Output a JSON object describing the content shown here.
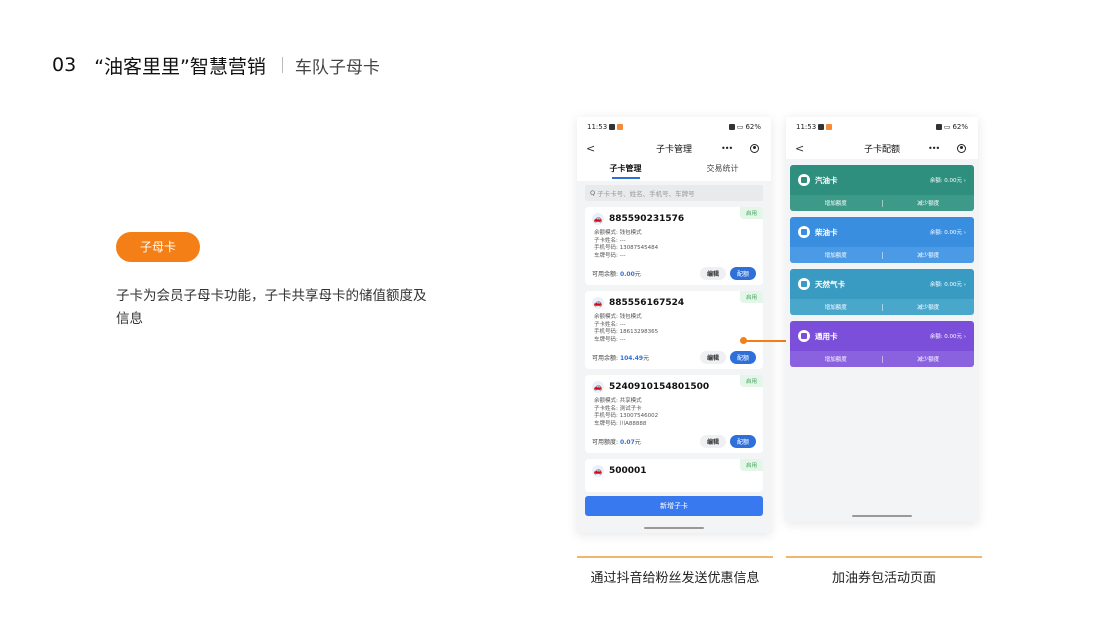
{
  "header": {
    "number": "03",
    "title": "“油客里里”智慧营销",
    "subtitle": "车队子母卡"
  },
  "tag": "子母卡",
  "description": "子卡为会员子母卡功能，子卡共享母卡的储值额度及信息",
  "phone1": {
    "status": {
      "time": "11:53",
      "battery": "62%"
    },
    "nav_title": "子卡管理",
    "tabs": [
      "子卡管理",
      "交易统计"
    ],
    "search_placeholder": "子卡卡号、姓名、手机号、车牌号",
    "cards": [
      {
        "number": "885590231576",
        "badge": "启用",
        "lines": [
          "余额模式: 钱包模式",
          "子卡姓名: ---",
          "手机号码: 13087545484",
          "车牌号码: ---"
        ],
        "balance_label": "可用余额:",
        "balance": "0.00",
        "unit": "元",
        "edit": "编辑",
        "config": "配额"
      },
      {
        "number": "885556167524",
        "badge": "启用",
        "lines": [
          "余额模式: 钱包模式",
          "子卡姓名: ---",
          "手机号码: 18613298365",
          "车牌号码: ---"
        ],
        "balance_label": "可用余额:",
        "balance": "104.49",
        "unit": "元",
        "edit": "编辑",
        "config": "配额"
      },
      {
        "number": "5240910154801500",
        "badge": "启用",
        "lines": [
          "余额模式: 共享模式",
          "子卡姓名: 测试子卡",
          "手机号码: 13007546002",
          "车牌号码: 川A88888"
        ],
        "balance_label": "可用额度:",
        "balance": "0.07",
        "unit": "元",
        "edit": "编辑",
        "config": "配额"
      },
      {
        "number": "500001",
        "badge": "启用"
      }
    ],
    "add_button": "新增子卡"
  },
  "phone2": {
    "status": {
      "time": "11:53",
      "battery": "62%"
    },
    "nav_title": "子卡配额",
    "fuels": [
      {
        "name": "汽油卡",
        "balance": "余额: 0.00元",
        "add": "增加额度",
        "reduce": "减少额度",
        "color": "#2f8f7e",
        "bottom_color": "#3d9a89"
      },
      {
        "name": "柴油卡",
        "balance": "余额: 0.00元",
        "add": "增加额度",
        "reduce": "减少额度",
        "color": "#3a8ee0",
        "bottom_color": "#4a9ae6"
      },
      {
        "name": "天然气卡",
        "balance": "余额: 0.00元",
        "add": "增加额度",
        "reduce": "减少额度",
        "color": "#3a9bc2",
        "bottom_color": "#4aa7cc"
      },
      {
        "name": "通用卡",
        "balance": "余额: 0.00元",
        "add": "增加额度",
        "reduce": "减少额度",
        "color": "#7b4fd9",
        "bottom_color": "#8a62e0"
      }
    ]
  },
  "captions": [
    "通过抖音给粉丝发送优惠信息",
    "加油券包活动页面"
  ],
  "colors": {
    "accent": "#f57f17",
    "primary_blue": "#2f6fd9"
  }
}
